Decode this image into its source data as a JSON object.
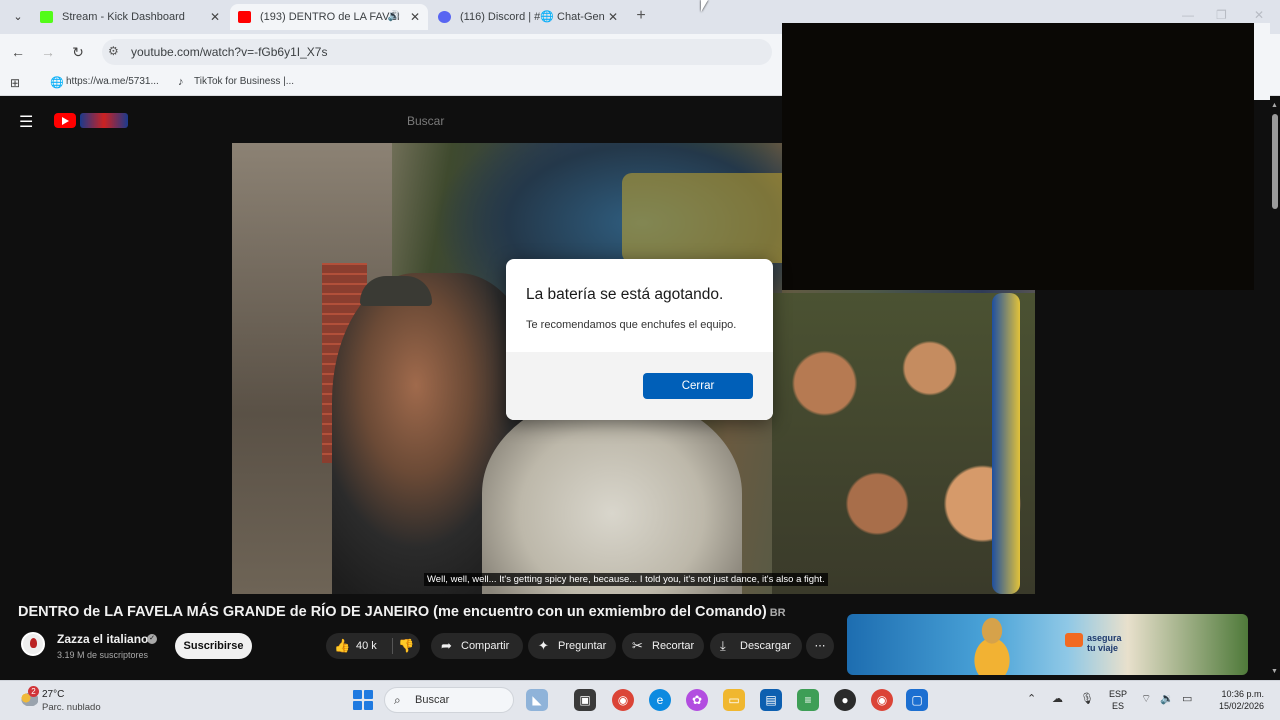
{
  "browser": {
    "tabs": [
      {
        "title": "Stream - Kick Dashboard",
        "favicon_color": "#53fc18",
        "active": false
      },
      {
        "title": "(193) DENTRO de LA FAVEI",
        "favicon_color": "#ff0000",
        "active": true
      },
      {
        "title": "(116) Discord | #🌐 Chat-Gen",
        "favicon_color": "#5865f2",
        "active": false
      }
    ],
    "address": "youtube.com/watch?v=-fGb6y1I_X7s",
    "bookmarks": [
      {
        "label": "https://wa.me/5731...",
        "icon": "globe-icon"
      },
      {
        "label": "TikTok for Business |...",
        "icon": "tiktok-icon"
      }
    ]
  },
  "youtube": {
    "search_placeholder": "Buscar",
    "subtitle": "Well, well, well... It's getting spicy here, because... I told you, it's not just dance, it's also a fight.",
    "video_title": "DENTRO de LA FAVELA MÁS GRANDE de RÍO DE JANEIRO (me encuentro con un exmiembro del Comando)",
    "title_badge": "BR",
    "channel": {
      "name": "Zazza el italiano",
      "subscribers": "3.19 M de suscriptores",
      "subscribe_label": "Suscribirse"
    },
    "actions": {
      "likes": "40 k",
      "share": "Compartir",
      "ask": "Preguntar",
      "clip": "Recortar",
      "download": "Descargar"
    },
    "ad": {
      "line1": "asegura",
      "line2": "tu viaje"
    }
  },
  "dialog": {
    "title": "La batería se está agotando.",
    "body": "Te recomendamos que enchufes el equipo.",
    "close_label": "Cerrar"
  },
  "taskbar": {
    "temperature": "27°C",
    "condition": "Parc. nublado",
    "weather_badge": "2",
    "search_label": "Buscar",
    "lang_top": "ESP",
    "lang_bottom": "ES",
    "time": "10:36 p.m.",
    "date": "15/02/2026"
  },
  "colors": {
    "accent": "#005fb8",
    "youtube_red": "#ff0000",
    "youtube_bg": "#0f0f0f"
  }
}
